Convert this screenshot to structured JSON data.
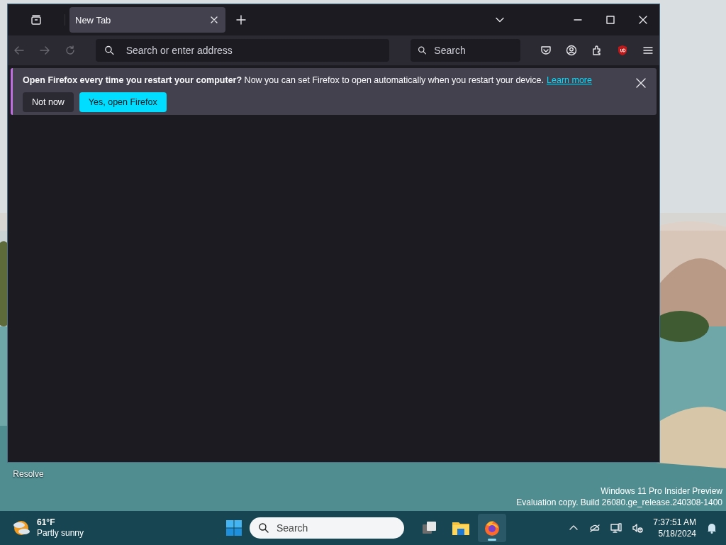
{
  "browser": {
    "tabs": [
      {
        "label": "New Tab",
        "selected": true
      }
    ],
    "address_bar": {
      "placeholder": "Search or enter address"
    },
    "search_field": {
      "placeholder": "Search"
    },
    "notification": {
      "message": "**Open Firefox every time you restart your computer?** Now you can set Firefox to open automatically when you restart your device.",
      "link": "Learn more",
      "buttons": [
        {
          "label": "Not now",
          "kind": "secondary"
        },
        {
          "label": "Yes, open Firefox",
          "kind": "primary"
        }
      ]
    }
  },
  "desktop": {
    "icon_label": "Resolve",
    "edition": [
      "Windows 11 Pro Insider Preview",
      "Evaluation copy. Build 26080.ge_release.240308-1400"
    ]
  },
  "taskbar": {
    "weather": {
      "temperature": "61°F",
      "condition": "Partly sunny"
    },
    "search": {
      "placeholder": "Search"
    },
    "apps": [
      {
        "kind": "task-view",
        "selected": false
      },
      {
        "kind": "files",
        "selected": false
      },
      {
        "kind": "firefox",
        "selected": true
      }
    ],
    "clock": {
      "time": "7:37:51 AM",
      "date": "5/18/2024"
    }
  }
}
